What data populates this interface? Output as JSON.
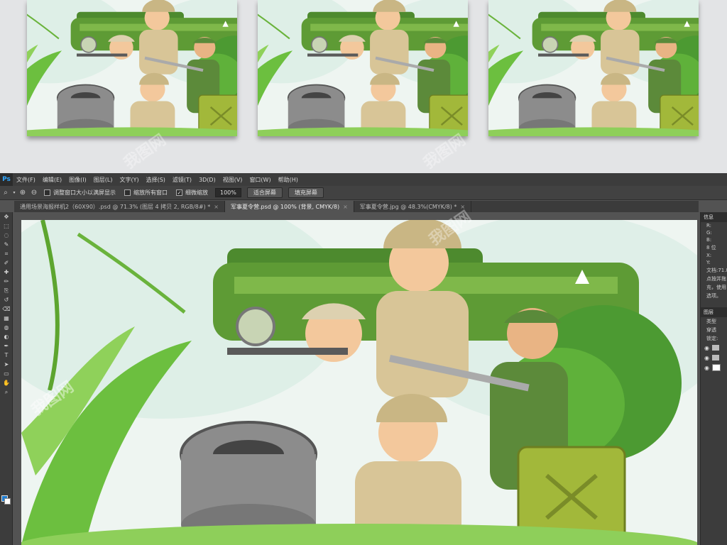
{
  "app": {
    "logo": "Ps",
    "menu": [
      "文件(F)",
      "编辑(E)",
      "图像(I)",
      "图层(L)",
      "文字(Y)",
      "选择(S)",
      "滤镜(T)",
      "3D(D)",
      "视图(V)",
      "窗口(W)",
      "帮助(H)"
    ]
  },
  "options": {
    "checkbox_fit_windows": "调整窗口大小以满屏显示",
    "checkbox_zoom_all": "缩放所有窗口",
    "checkbox_scrubby": "细微缩放",
    "zoom_value": "100%",
    "btn_fit_screen": "适合屏幕",
    "btn_fill_screen": "填充屏幕"
  },
  "tabs": [
    {
      "label": "通用场景海报样机2（60X90）.psd @ 71.3% (图层 4 拷贝 2, RGB/8#) *",
      "active": false
    },
    {
      "label": "军事夏令营.psd @ 100% (背景, CMYK/8)",
      "active": true
    },
    {
      "label": "军事夏令营.jpg @ 48.3%(CMYK/8) *",
      "active": false
    }
  ],
  "info_panel": {
    "tab": "信息",
    "lines": [
      "R:",
      "G:",
      "B:",
      "8 位",
      "X:",
      "Y:",
      "文档:71.8",
      "点按并拖",
      "充，使用",
      "选项。"
    ]
  },
  "layers_panel": {
    "tab": "图层",
    "filter_label": "类型",
    "blend_mode": "穿透",
    "lock_label": "锁定:"
  },
  "watermark": "我图网",
  "icons": [
    "move-icon",
    "marquee-icon",
    "lasso-icon",
    "quick-select-icon",
    "crop-icon",
    "eyedropper-icon",
    "heal-icon",
    "brush-icon",
    "stamp-icon",
    "history-brush-icon",
    "eraser-icon",
    "gradient-icon",
    "blur-icon",
    "dodge-icon",
    "pen-icon",
    "type-icon",
    "path-select-icon",
    "shape-icon",
    "hand-icon",
    "zoom-icon"
  ]
}
